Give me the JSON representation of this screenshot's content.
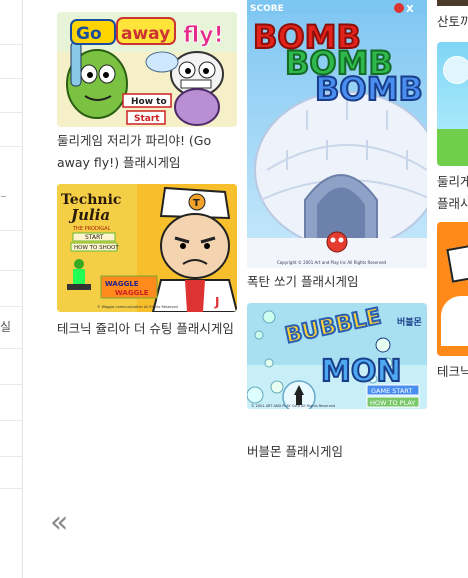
{
  "sidebar": {
    "fragment": "실"
  },
  "games": [
    {
      "caption": "둘리게임 저리가 파리야! (Go away fly!) 플래시게임",
      "title_art": "Go away fly!",
      "btn1": "How to",
      "btn2": "Start"
    },
    {
      "caption": "테크닉 쥴리아 더 슈팅 플래시게임",
      "title_art_1": "Technic",
      "title_art_2": "Julia",
      "title_art_3": "THE PRODIGAL",
      "btn1": "START",
      "btn2": "HOW TO SHOOT",
      "badge": "WAGGLE WAGGLE",
      "copyright": "© Waggle communication All Rights Reserved"
    },
    {
      "caption": "폭탄 쏘기 플래시게임",
      "score_label": "SCORE",
      "close_label": "X",
      "word": "BOMB",
      "copyright": "Copyright © 2001 Art and Play Inc All Rights Reserved"
    },
    {
      "caption": "버블몬 플래시게임",
      "word1": "BUBBLE",
      "word2": "MON",
      "korean_tag": "버블몬",
      "btn1": "GAME START",
      "btn2": "HOW TO PLAY",
      "copyright": "© 2001 ART AND PLAY Corp All Rights Reserved"
    },
    {
      "caption": "산토끼"
    },
    {
      "caption": "둘리게임 플래시게임"
    },
    {
      "caption": "테크닉"
    }
  ],
  "pager": {
    "prev_label": "«"
  }
}
